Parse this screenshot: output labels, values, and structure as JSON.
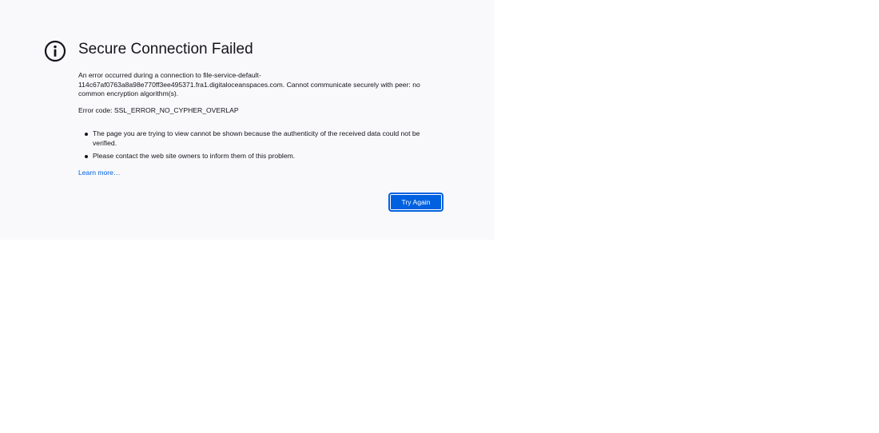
{
  "page": {
    "title": "Secure Connection Failed",
    "description": "An error occurred during a connection to file-service-default-114c67af0763a8a98e770ff3ee495371.fra1.digitaloceanspaces.com. Cannot communicate securely with peer: no common encryption algorithm(s).",
    "error_code": "Error code: SSL_ERROR_NO_CYPHER_OVERLAP",
    "bullets": [
      "The page you are trying to view cannot be shown because the authenticity of the received data could not be verified.",
      "Please contact the web site owners to inform them of this problem."
    ],
    "learn_more": "Learn more…",
    "try_again": "Try Again"
  },
  "colors": {
    "panel_background": "#f9f9fb",
    "accent": "#0061e0",
    "text": "#15141a"
  },
  "icons": {
    "title_icon": "info-icon"
  }
}
